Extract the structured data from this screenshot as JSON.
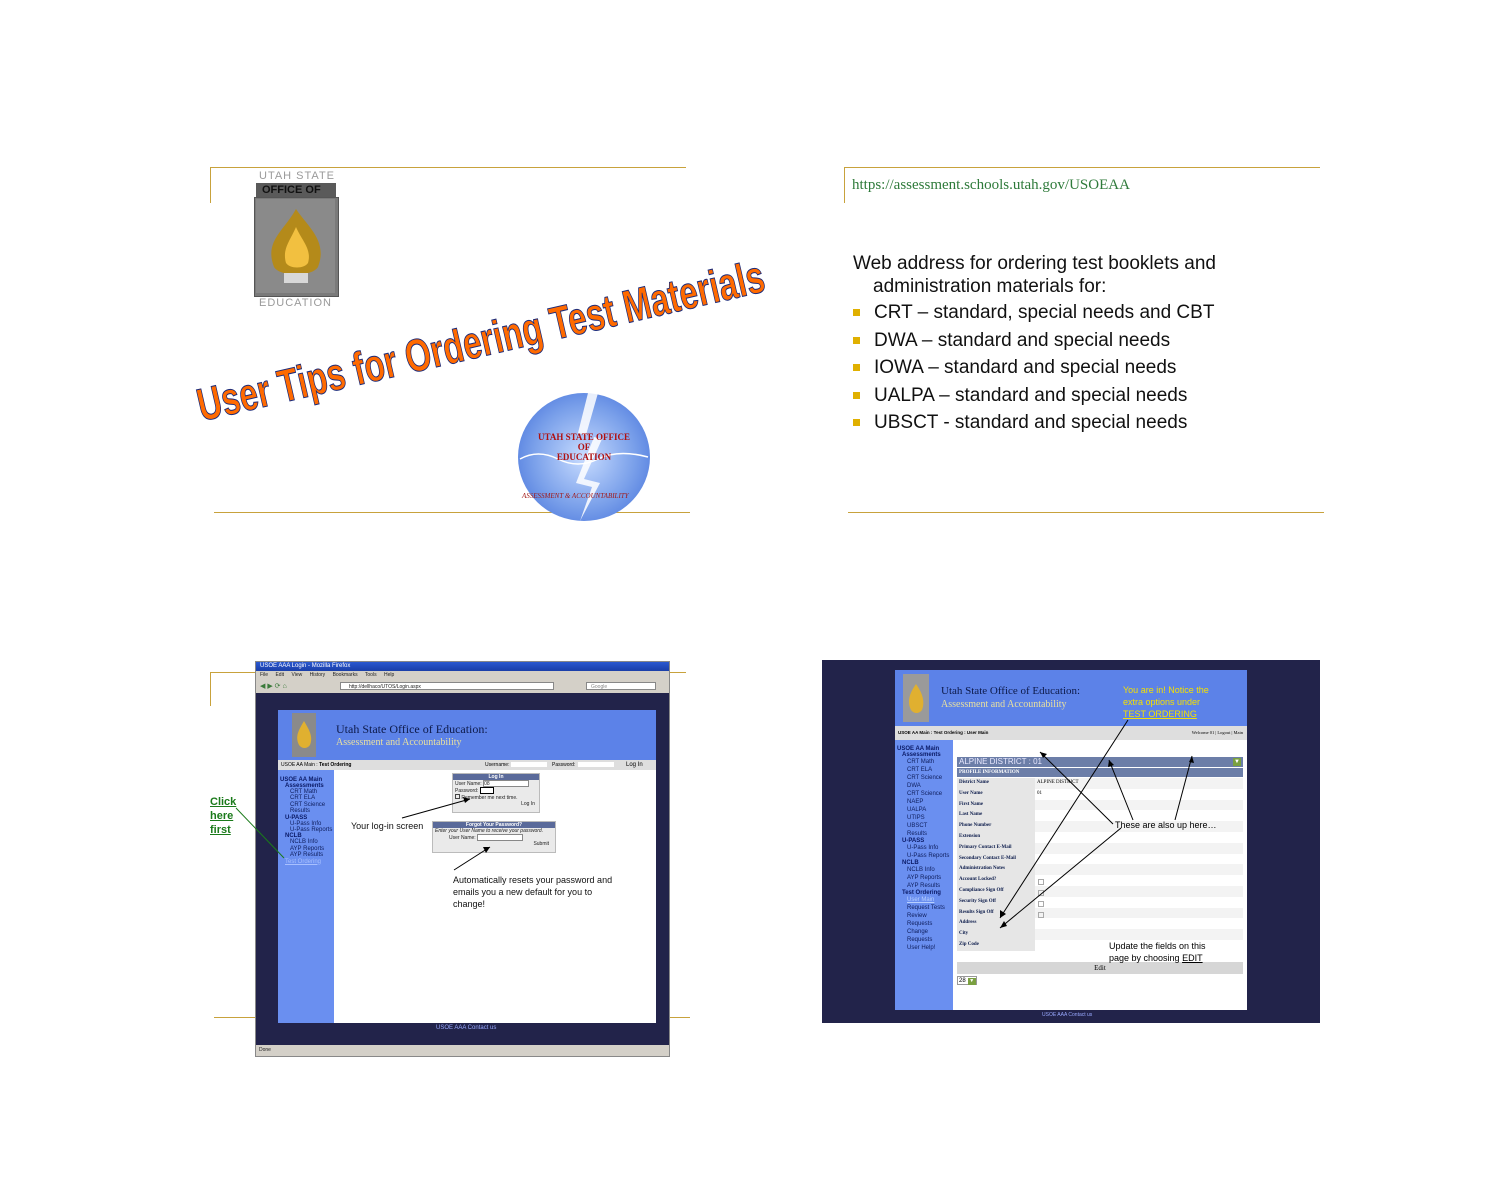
{
  "slide1": {
    "logo_top": "UTAH STATE",
    "logo_mid": "OFFICE OF",
    "logo_bottom": "EDUCATION",
    "title": "User Tips for Ordering Test Materials",
    "seal_line1": "UTAH STATE OFFICE",
    "seal_line2": "OF",
    "seal_line3": "EDUCATION",
    "seal_bottom": "ASSESSMENT & ACCOUNTABILITY"
  },
  "slide2": {
    "url": "https://assessment.schools.utah.gov/USOEAA",
    "intro_line1": "Web address for ordering test booklets and",
    "intro_line2": "administration materials for:",
    "bullets": [
      "CRT – standard, special needs and CBT",
      "DWA – standard and special needs",
      "IOWA – standard and special needs",
      "UALPA – standard and special needs",
      "UBSCT - standard and special needs"
    ]
  },
  "slide3": {
    "window_title": "USOE AAA Login - Mozilla Firefox",
    "menu": [
      "File",
      "Edit",
      "View",
      "History",
      "Bookmarks",
      "Tools",
      "Help"
    ],
    "address": "http://dellhaco/UTOS/Login.aspx",
    "search_placeholder": "Google",
    "site_title": "Utah State Office of Education:",
    "site_subtitle": "Assessment and Accountability",
    "breadcrumb_main": "USOE AA Main :",
    "breadcrumb_current": "Test Ordering",
    "username_label": "Username:",
    "password_label": "Password:",
    "login_button": "Log In",
    "nav": {
      "main": "USOE AA Main",
      "assessments": "Assessments",
      "assessment_items": [
        "CRT Math",
        "CRT ELA",
        "CRT Science",
        "Results"
      ],
      "upass": "U-PASS",
      "upass_items": [
        "U-Pass Info",
        "U-Pass Reports"
      ],
      "nclb": "NCLB",
      "nclb_items": [
        "NCLB Info",
        "AYP Reports",
        "AYP Results"
      ],
      "test_ordering": "Test Ordering"
    },
    "login_box": {
      "title": "Log In",
      "user_label": "User Name:",
      "user_value": "08",
      "pass_label": "Password:",
      "remember": "Remember me next time.",
      "button": "Log In"
    },
    "forgot_box": {
      "title": "Forgot Your Password?",
      "hint": "Enter your User Name to receive your password.",
      "user_label": "User Name:",
      "button": "Submit"
    },
    "footer_links": "USOE  AAA  Contact us",
    "status": "Done",
    "click_here": [
      "Click",
      "here",
      "first"
    ],
    "caption_login": "Your log-in screen",
    "caption_reset_1": "Automatically resets your password and",
    "caption_reset_2": "emails you a new default for you to",
    "caption_reset_3": "change!"
  },
  "slide4": {
    "site_title": "Utah State Office of Education:",
    "site_subtitle": "Assessment and Accountability",
    "breadcrumb": "USOE AA Main : Test Ordering : User Main",
    "welcome": "Welcome 01 | Logout | Main",
    "annotation_top_1": "You are in!  Notice the",
    "annotation_top_2": "extra options under",
    "annotation_top_3": "TEST ORDERING",
    "tabs": [
      "PROFILE",
      "ADD TESTS",
      "REVIEW ORDERS",
      "CHANGE RECENT",
      "HELP!"
    ],
    "district_select": "ALPINE DISTRICT : 01",
    "profile_header": "PROFILE INFORMATION",
    "fields": [
      {
        "label": "District Name",
        "value": "ALPINE DISTRICT"
      },
      {
        "label": "User Name",
        "value": "01"
      },
      {
        "label": "First Name",
        "value": ""
      },
      {
        "label": "Last Name",
        "value": ""
      },
      {
        "label": "Phone Number",
        "value": ""
      },
      {
        "label": "Extension",
        "value": ""
      },
      {
        "label": "Primary Contact E-Mail",
        "value": ""
      },
      {
        "label": "Secondary Contact E-Mail",
        "value": ""
      },
      {
        "label": "Administration Notes",
        "value": ""
      },
      {
        "label": "Account Locked?",
        "value": ""
      },
      {
        "label": "Compliance Sign Off",
        "value": ""
      },
      {
        "label": "Security Sign Off",
        "value": ""
      },
      {
        "label": "Results Sign Off",
        "value": ""
      },
      {
        "label": "Address",
        "value": ""
      },
      {
        "label": "City",
        "value": ""
      },
      {
        "label": "Zip Code",
        "value": ""
      }
    ],
    "edit_button": "Edit",
    "page_select": "28",
    "annotation_mid": "These are also up here…",
    "annotation_bottom_1": "Update the fields on this",
    "annotation_bottom_2": "page by choosing",
    "annotation_bottom_3": "EDIT",
    "nav": {
      "main": "USOE AA Main",
      "assessments": "Assessments",
      "assessment_items": [
        "CRT Math",
        "CRT ELA",
        "CRT Science",
        "DWA",
        "CRT Science",
        "NAEP",
        "UALPA",
        "UTIPS",
        "UBSCT",
        "Results"
      ],
      "upass": "U-PASS",
      "upass_items": [
        "U-Pass Info",
        "U-Pass Reports"
      ],
      "nclb": "NCLB",
      "nclb_items": [
        "NCLB Info",
        "AYP Reports",
        "AYP Results"
      ],
      "test_ordering": "Test Ordering",
      "to_items": [
        "User Main",
        "Request Tests",
        "Review Requests",
        "Change Requests",
        "User Help!"
      ]
    },
    "footer_links": "USOE  AAA  Contact us"
  }
}
